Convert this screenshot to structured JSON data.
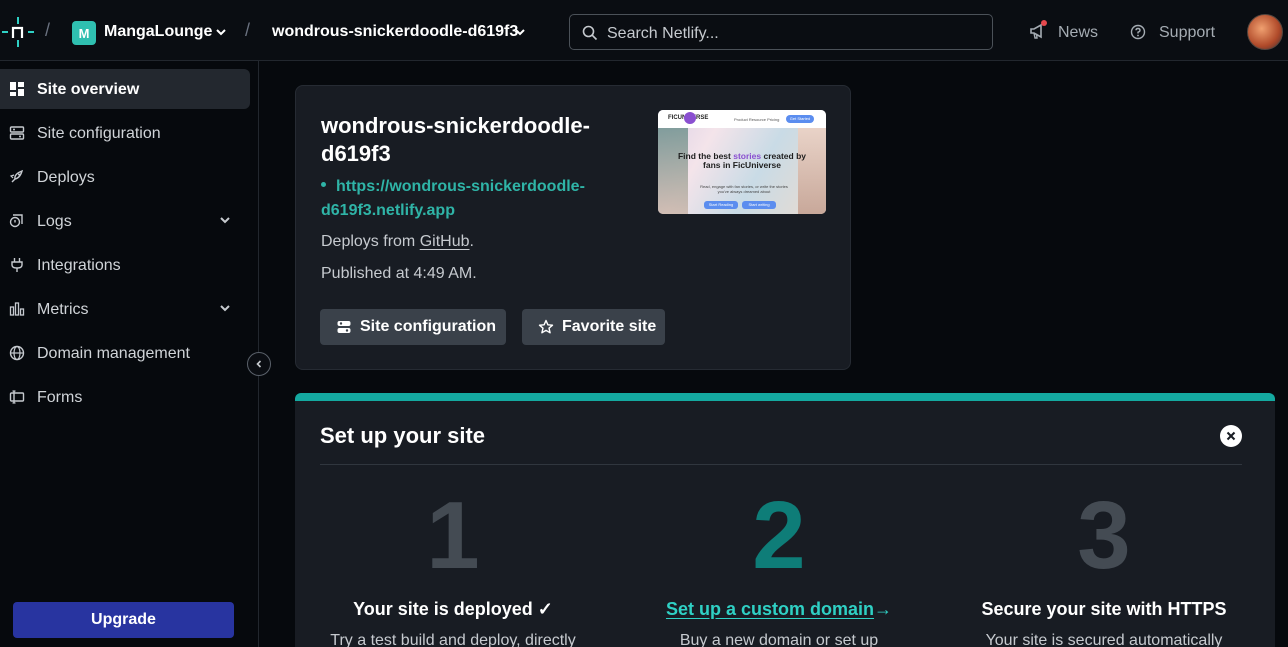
{
  "header": {
    "team_initial": "M",
    "team_name": "MangaLounge",
    "site_name": "wondrous-snickerdoodle-d619f3",
    "search_placeholder": "Search Netlify...",
    "news_label": "News",
    "support_label": "Support",
    "separator": "/"
  },
  "sidebar": {
    "items": [
      {
        "label": "Site overview",
        "icon": "dashboard-icon",
        "active": true
      },
      {
        "label": "Site configuration",
        "icon": "settings-panel-icon"
      },
      {
        "label": "Deploys",
        "icon": "rocket-icon"
      },
      {
        "label": "Logs",
        "icon": "logs-icon",
        "expandable": true
      },
      {
        "label": "Integrations",
        "icon": "plug-icon"
      },
      {
        "label": "Metrics",
        "icon": "bar-chart-icon",
        "expandable": true
      },
      {
        "label": "Domain management",
        "icon": "globe-icon"
      },
      {
        "label": "Forms",
        "icon": "forms-icon"
      }
    ],
    "upgrade_label": "Upgrade"
  },
  "site_card": {
    "title": "wondrous-snickerdoodle-d619f3",
    "url": "https://wondrous-snickerdoodle-d619f3.netlify.app",
    "deploys_prefix": "Deploys from",
    "deploys_source": "GitHub",
    "deploys_suffix": ".",
    "published": "Published at 4:49 AM.",
    "config_button": "Site configuration",
    "favorite_button": "Favorite site",
    "preview": {
      "logo": "FICUNIVERSE",
      "nav_links": "Product  Resource  Pricing",
      "pill": "Get Started",
      "headline_pre": "Find the best",
      "headline_accent": "stories",
      "headline_post": "created by fans in FicUniverse",
      "subtext": "Read, engage with fan stories, or write the stories you've always dreamed about",
      "button1": "Start Reading",
      "button2": "Start writing"
    }
  },
  "setup": {
    "title": "Set up your site",
    "steps": [
      {
        "number": "1",
        "title": "Your site is deployed ✓",
        "description": "Try a test build and deploy, directly"
      },
      {
        "number": "2",
        "title": "Set up a custom domain",
        "arrow": "→",
        "description": "Buy a new domain or set up"
      },
      {
        "number": "3",
        "title": "Secure your site with HTTPS",
        "description": "Your site is secured automatically"
      }
    ]
  },
  "colors": {
    "accent_teal": "#14a9a0",
    "link_teal": "#2fd0c4",
    "upgrade_blue": "#2834a0",
    "background": "#06090d"
  }
}
